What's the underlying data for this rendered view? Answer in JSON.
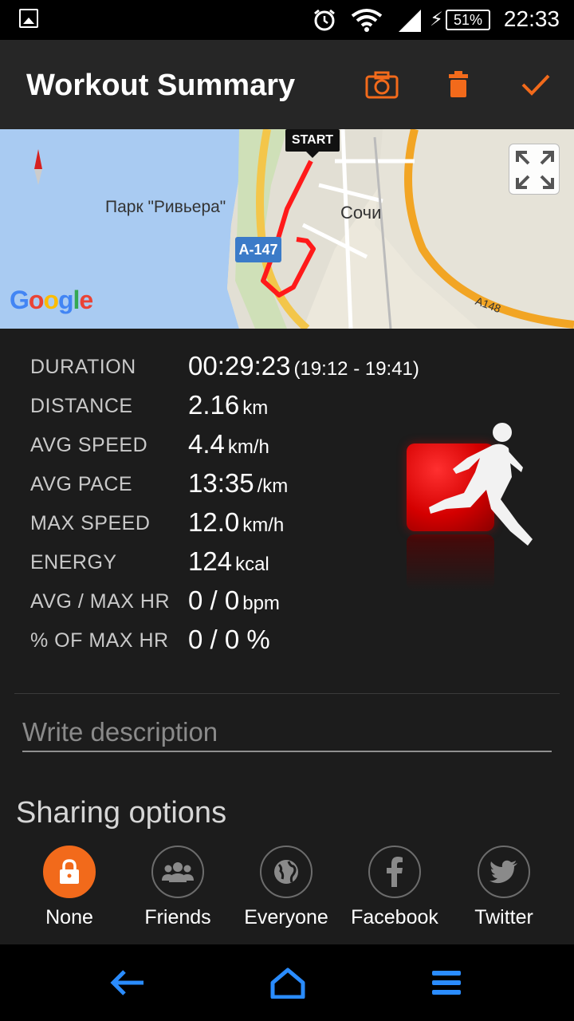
{
  "status_bar": {
    "time": "22:33",
    "battery": "51%",
    "icons": [
      "image-icon",
      "alarm-icon",
      "wifi-icon",
      "signal-icon",
      "charging-icon"
    ]
  },
  "app_bar": {
    "title": "Workout Summary",
    "actions": [
      "camera-icon",
      "trash-icon",
      "checkmark-icon"
    ],
    "accent": "#f26a1b"
  },
  "map": {
    "start_label": "START",
    "park_label": "Парк \"Ривьера\"",
    "city_label": "Сочи",
    "road_shield": "A-147",
    "road_label": "A148",
    "provider": "Google"
  },
  "stats": [
    {
      "label": "DURATION",
      "value": "00:29:23",
      "unit": "(19:12 - 19:41)"
    },
    {
      "label": "DISTANCE",
      "value": "2.16",
      "unit": "km"
    },
    {
      "label": "AVG SPEED",
      "value": "4.4",
      "unit": "km/h"
    },
    {
      "label": "AVG PACE",
      "value": "13:35",
      "unit": "/km"
    },
    {
      "label": "MAX SPEED",
      "value": "12.0",
      "unit": "km/h"
    },
    {
      "label": "ENERGY",
      "value": "124",
      "unit": "kcal"
    },
    {
      "label": "AVG / MAX HR",
      "value": "0 / 0",
      "unit": "bpm"
    },
    {
      "label": "% OF MAX HR",
      "value": "0 / 0 %",
      "unit": ""
    }
  ],
  "description": {
    "placeholder": "Write description",
    "value": ""
  },
  "sharing": {
    "title": "Sharing options",
    "options": [
      {
        "label": "None",
        "icon": "lock-icon",
        "selected": true
      },
      {
        "label": "Friends",
        "icon": "people-icon",
        "selected": false
      },
      {
        "label": "Everyone",
        "icon": "globe-icon",
        "selected": false
      },
      {
        "label": "Facebook",
        "icon": "facebook-icon",
        "selected": false
      },
      {
        "label": "Twitter",
        "icon": "twitter-icon",
        "selected": false
      }
    ]
  },
  "nav_bar": {
    "buttons": [
      "back-icon",
      "home-icon",
      "menu-icon"
    ],
    "color": "#2a8cff"
  }
}
